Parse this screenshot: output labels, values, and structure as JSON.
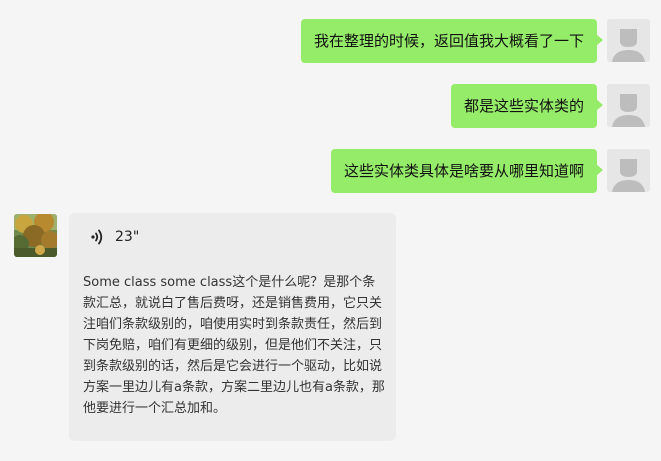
{
  "messages_out": [
    {
      "text": "我在整理的时候，返回值我大概看了一下"
    },
    {
      "text": "都是这些实体类的"
    },
    {
      "text": "这些实体类具体是啥要从哪里知道啊"
    }
  ],
  "voice_message": {
    "duration": "23\"",
    "transcript": "Some class some class这个是什么呢？是那个条款汇总，就说白了售后费呀，还是销售费用，它只关注咱们条款级别的，咱使用实时到条款责任，然后到下岗免赔，咱们有更细的级别，但是他们不关注，只到条款级别的话，然后是它会进行一个驱动，比如说方案一里边儿有a条款，方案二里边儿也有a条款，那他要进行一个汇总加和。"
  },
  "colors": {
    "outgoing_bubble": "#95ec69",
    "incoming_bubble": "#ececec",
    "background": "#f5f5f5"
  },
  "icons": {
    "self_avatar": "default-avatar-icon",
    "other_avatar": "landscape-photo-avatar",
    "voice": "voice-wave-icon"
  }
}
